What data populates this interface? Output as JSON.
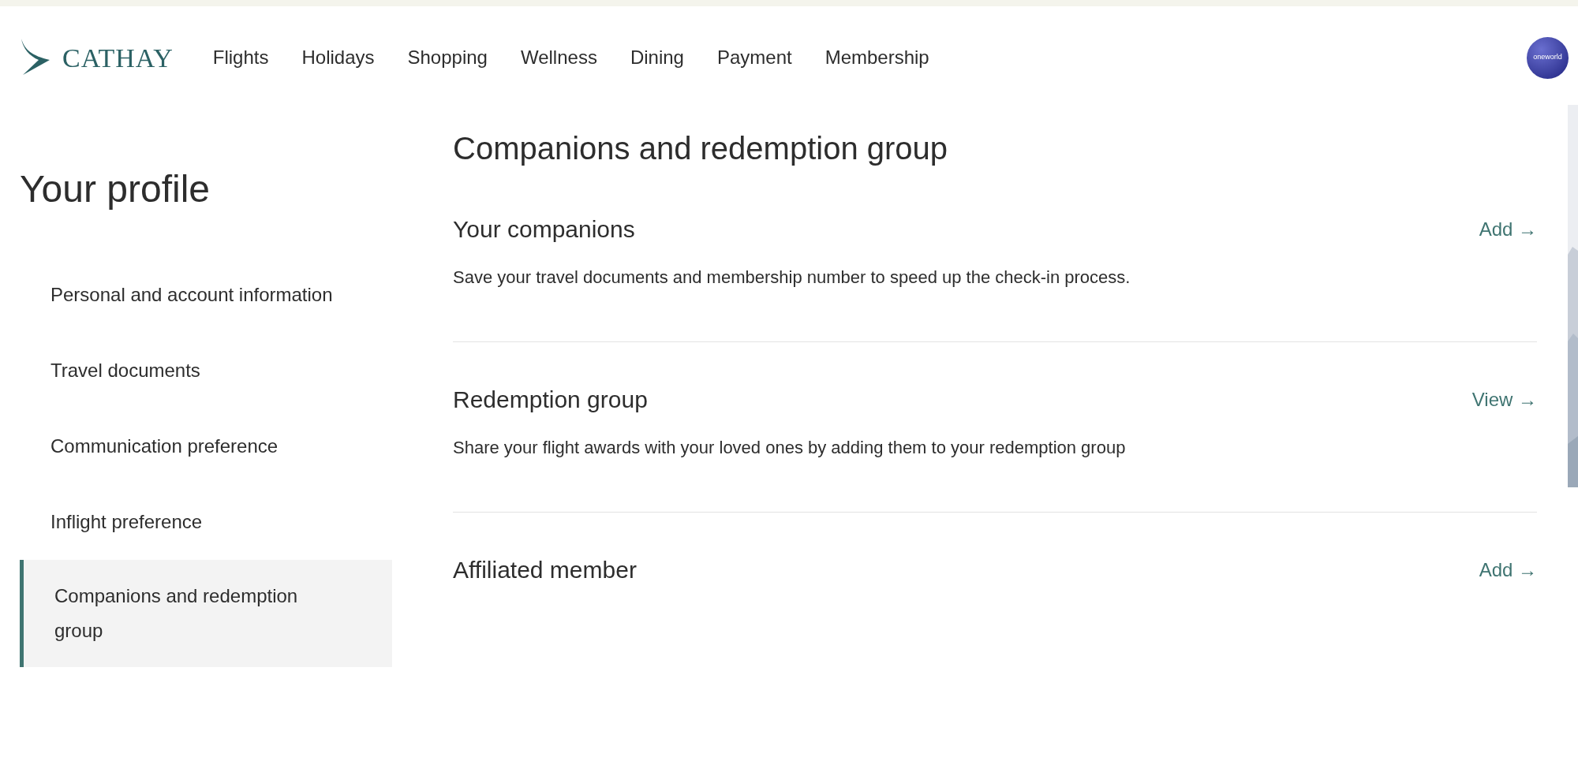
{
  "header": {
    "brand": "CATHAY",
    "nav": [
      {
        "label": "Flights"
      },
      {
        "label": "Holidays"
      },
      {
        "label": "Shopping"
      },
      {
        "label": "Wellness"
      },
      {
        "label": "Dining"
      },
      {
        "label": "Payment"
      },
      {
        "label": "Membership"
      }
    ],
    "alliance_badge": "oneworld"
  },
  "sidebar": {
    "title": "Your profile",
    "items": [
      {
        "label": "Personal and account information",
        "selected": false
      },
      {
        "label": "Travel documents",
        "selected": false
      },
      {
        "label": "Communication preference",
        "selected": false
      },
      {
        "label": "Inflight preference",
        "selected": false
      },
      {
        "label": "Companions and redemption group",
        "selected": true
      }
    ]
  },
  "main": {
    "title": "Companions and redemption group",
    "sections": [
      {
        "heading": "Your companions",
        "action": "Add →",
        "description": "Save your travel documents and membership number to speed up the check-in process."
      },
      {
        "heading": "Redemption group",
        "action": "View →",
        "description": "Share your flight awards with your loved ones by adding them to your redemption group"
      },
      {
        "heading": "Affiliated member",
        "action": "Add →"
      }
    ]
  }
}
